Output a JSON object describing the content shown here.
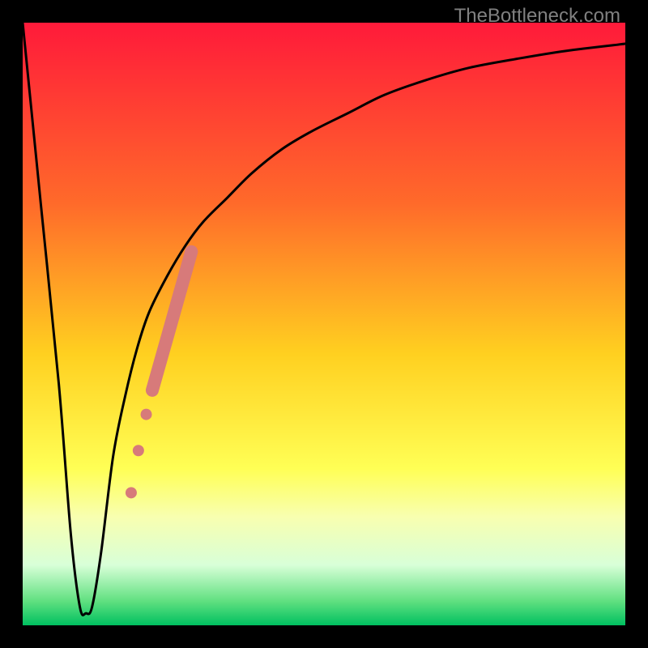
{
  "watermark": "TheBottleneck.com",
  "chart_data": {
    "type": "line",
    "title": "",
    "xlabel": "",
    "ylabel": "",
    "xlim": [
      0,
      100
    ],
    "ylim": [
      0,
      100
    ],
    "gradient_stops": [
      {
        "offset": 0,
        "color": "#ff1a3a"
      },
      {
        "offset": 30,
        "color": "#ff6a2a"
      },
      {
        "offset": 55,
        "color": "#ffd020"
      },
      {
        "offset": 74,
        "color": "#ffff55"
      },
      {
        "offset": 82,
        "color": "#f8ffb0"
      },
      {
        "offset": 90,
        "color": "#d8ffd8"
      },
      {
        "offset": 96,
        "color": "#60e080"
      },
      {
        "offset": 100,
        "color": "#00c060"
      }
    ],
    "series": [
      {
        "name": "bottleneck-curve",
        "x": [
          0,
          3,
          6,
          8,
          9.5,
          10.5,
          11.5,
          13,
          15,
          17,
          19,
          21,
          24,
          27,
          30,
          34,
          38,
          43,
          48,
          54,
          60,
          67,
          74,
          82,
          90,
          100
        ],
        "y": [
          100,
          70,
          40,
          15,
          3,
          2,
          3,
          12,
          28,
          38,
          46,
          52,
          58,
          63,
          67,
          71,
          75,
          79,
          82,
          85,
          88,
          90.5,
          92.5,
          94,
          95.3,
          96.5
        ]
      }
    ],
    "highlight_segment": {
      "name": "marker-band",
      "color": "#d77a7a",
      "points": [
        {
          "x": 18.0,
          "y": 22,
          "r": 7
        },
        {
          "x": 19.2,
          "y": 29,
          "r": 7
        },
        {
          "x": 20.5,
          "y": 35,
          "r": 7
        }
      ],
      "thick_line": {
        "x0": 21.5,
        "y0": 39,
        "x1": 28.0,
        "y1": 62,
        "width": 16
      }
    }
  }
}
